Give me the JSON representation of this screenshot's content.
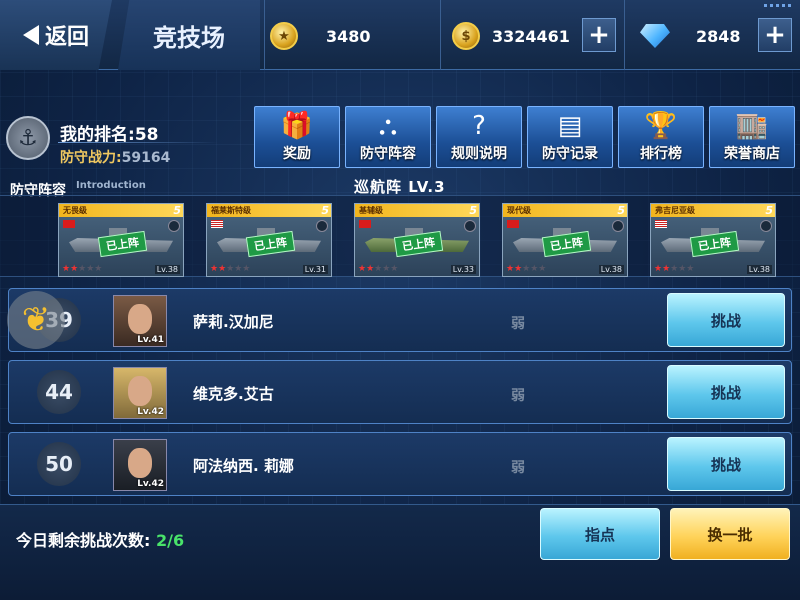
{
  "header": {
    "back_label": "返回",
    "title": "竞技场",
    "resources": [
      {
        "icon": "medal-coin-icon",
        "value": "3480"
      },
      {
        "icon": "gold-coin-icon",
        "value": "3324461"
      },
      {
        "icon": "diamond-icon",
        "value": "2848"
      }
    ],
    "plus_symbol": "+"
  },
  "player": {
    "rank_label": "我的排名:",
    "rank_value": "58",
    "power_label": "防守战力:",
    "power_value": "59164"
  },
  "menu": [
    {
      "label": "奖励",
      "icon": "gift-icon",
      "glyph": "🎁"
    },
    {
      "label": "防守阵容",
      "icon": "formation-icon",
      "glyph": "⛬"
    },
    {
      "label": "规则说明",
      "icon": "question-icon",
      "glyph": "?"
    },
    {
      "label": "防守记录",
      "icon": "record-icon",
      "glyph": "▤"
    },
    {
      "label": "排行榜",
      "icon": "trophy-icon",
      "glyph": "🏆"
    },
    {
      "label": "荣誉商店",
      "icon": "shop-icon",
      "glyph": "🏬"
    }
  ],
  "defense": {
    "label": "防守阵容",
    "intro": "Introduction",
    "formation": "巡航阵 LV.3",
    "ships": [
      {
        "name": "无畏级",
        "flag": "cn",
        "level_badge": "5",
        "stamp": "已上阵",
        "stars": 2,
        "lv": "Lv.38"
      },
      {
        "name": "福莱斯特级",
        "flag": "us",
        "level_badge": "5",
        "stamp": "已上阵",
        "stars": 2,
        "lv": "Lv.31"
      },
      {
        "name": "基辅级",
        "flag": "cn",
        "level_badge": "5",
        "stamp": "已上阵",
        "stars": 2,
        "lv": "Lv.33"
      },
      {
        "name": "现代级",
        "flag": "cn",
        "level_badge": "5",
        "stamp": "已上阵",
        "stars": 2,
        "lv": "Lv.38"
      },
      {
        "name": "弗吉尼亚级",
        "flag": "us",
        "level_badge": "5",
        "stamp": "已上阵",
        "stars": 2,
        "lv": "Lv.38"
      }
    ]
  },
  "opponents": [
    {
      "rank": "39",
      "name": "萨莉.汉加尼",
      "level": "Lv.41",
      "difficulty": "弱",
      "button": "挑战",
      "avatar_style": "dark-red"
    },
    {
      "rank": "44",
      "name": "维克多.艾古",
      "level": "Lv.42",
      "difficulty": "弱",
      "button": "挑战",
      "avatar_style": "blonde"
    },
    {
      "rank": "50",
      "name": "阿法纳西. 莉娜",
      "level": "Lv.42",
      "difficulty": "弱",
      "button": "挑战",
      "avatar_style": "dark"
    }
  ],
  "footer": {
    "remain_label": "今日剩余挑战次数:",
    "remain_value": "2/6",
    "guide_button": "指点",
    "swap_button": "换一批"
  }
}
